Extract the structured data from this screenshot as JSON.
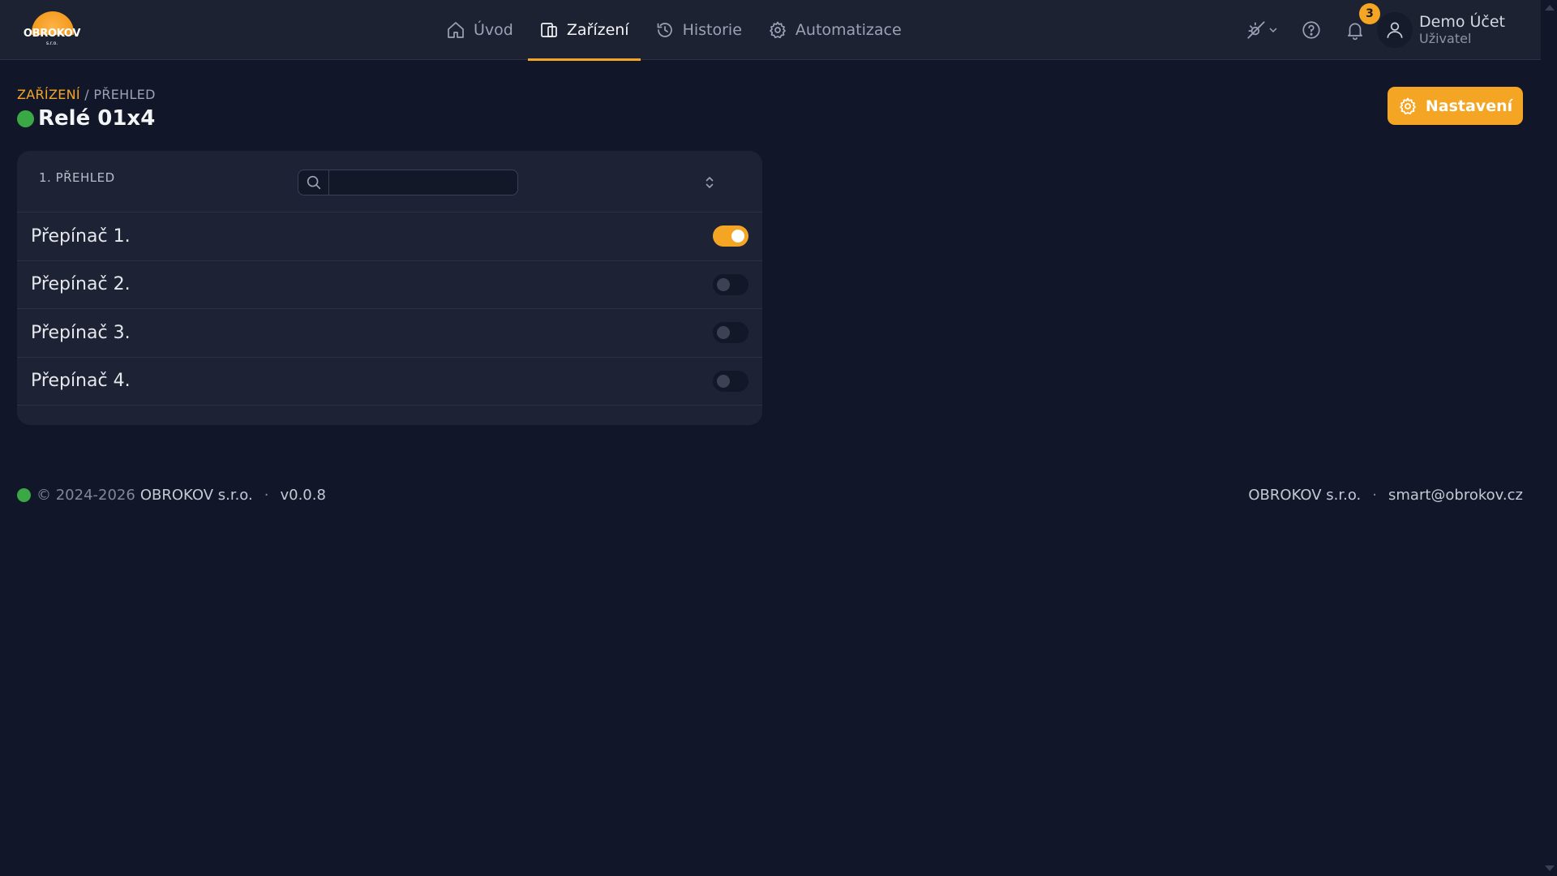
{
  "brand": {
    "name": "OBROKOV",
    "sub": "s.r.o.",
    "accent": "#f5a524"
  },
  "nav": {
    "items": [
      {
        "label": "Úvod",
        "icon": "home-icon"
      },
      {
        "label": "Zařízení",
        "icon": "devices-icon",
        "active": true
      },
      {
        "label": "Historie",
        "icon": "history-icon"
      },
      {
        "label": "Automatizace",
        "icon": "gear-icon"
      }
    ]
  },
  "toolbar": {
    "theme_icon": "sun-moon-icon",
    "help_icon": "help-icon",
    "notifications_count": "3"
  },
  "account": {
    "name": "Demo Účet",
    "role": "Uživatel"
  },
  "breadcrumb": {
    "parent": "ZAŘÍZENÍ",
    "separator": "/",
    "current": "PŘEHLED"
  },
  "page": {
    "title": "Relé 01x4",
    "status": "online",
    "status_color": "#3aa845"
  },
  "settings_button": {
    "label": "Nastavení"
  },
  "card": {
    "title": "1. PŘEHLED",
    "search": {
      "value": "",
      "placeholder": ""
    },
    "rows": [
      {
        "label": "Přepínač 1.",
        "on": true
      },
      {
        "label": "Přepínač 2.",
        "on": false
      },
      {
        "label": "Přepínač 3.",
        "on": false
      },
      {
        "label": "Přepínač 4.",
        "on": false
      }
    ]
  },
  "footer": {
    "copyright": "© 2024-2026",
    "company": "OBROKOV s.r.o.",
    "separator": "·",
    "version": "v0.0.8",
    "right_company": "OBROKOV s.r.o.",
    "email": "smart@obrokov.cz"
  }
}
